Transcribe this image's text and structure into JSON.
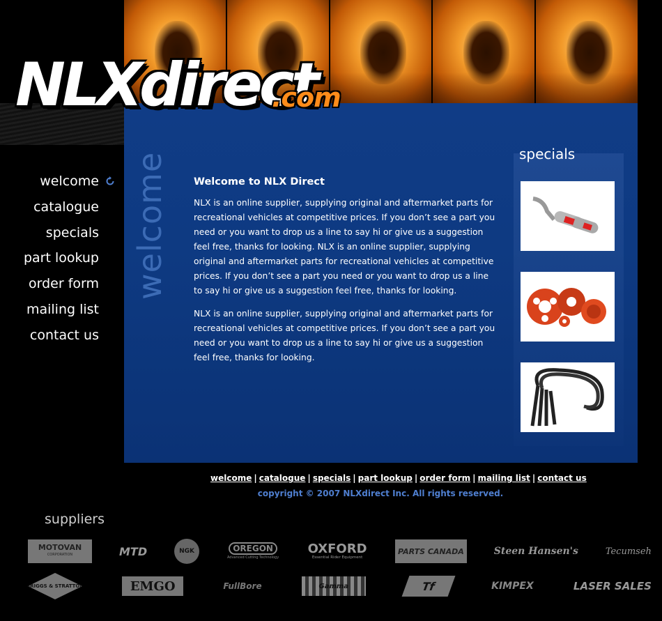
{
  "brand": {
    "logo_main": "NLXdirect",
    "logo_domain": ".com"
  },
  "nav": {
    "items": [
      {
        "label": "welcome"
      },
      {
        "label": "catalogue"
      },
      {
        "label": "specials"
      },
      {
        "label": "part lookup"
      },
      {
        "label": "order form"
      },
      {
        "label": "mailing list"
      },
      {
        "label": "contact us"
      }
    ]
  },
  "main": {
    "side_title": "welcome",
    "heading": "Welcome to NLX Direct",
    "paragraphs": [
      "NLX is an online supplier, supplying original and aftermarket parts for recreational vehicles at competitive prices. If you don’t see a part you need or you want to drop us a line to say hi or give us a suggestion feel free, thanks for looking. NLX is an online supplier, supplying original and aftermarket parts for recreational vehicles at competitive prices. If you don’t see a part you need or you want to drop us a line to say hi or give us a suggestion feel free, thanks for looking.",
      "NLX is an online supplier, supplying original and aftermarket parts for recreational vehicles at competitive prices. If you don’t see a part you need or you want to drop us a line to say hi or give us a suggestion feel free, thanks for looking."
    ]
  },
  "specials": {
    "title": "specials",
    "items": [
      {
        "icon": "exhaust-icon"
      },
      {
        "icon": "pulley-icon"
      },
      {
        "icon": "cable-icon"
      }
    ]
  },
  "footer": {
    "links": [
      "welcome",
      "catalogue",
      "specials",
      "part lookup",
      "order form",
      "mailing list",
      "contact us"
    ],
    "copyright": "copyright © 2007 NLXdirect Inc. All rights reserved."
  },
  "suppliers": {
    "title": "suppliers",
    "row1": [
      "MOTOVAN",
      "MTD",
      "NGK",
      "OREGON",
      "OXFORD",
      "PARTS CANADA",
      "Steen Hansen's",
      "Tecumseh"
    ],
    "row2": [
      "BRIGGS & STRATTON",
      "EMGO",
      "FullBore",
      "Gamma",
      "Tf",
      "KIMPEX",
      "LASER SALES"
    ],
    "logo_taglines": {
      "motovan": "CORPORATION",
      "oregon": "Advanced Cutting Technology",
      "oxford": "Essential Rider Equipment"
    }
  },
  "colors": {
    "panel_blue": "#0e3a82",
    "accent_orange": "#ff8c1a",
    "copyright_blue": "#4f7fd0"
  }
}
